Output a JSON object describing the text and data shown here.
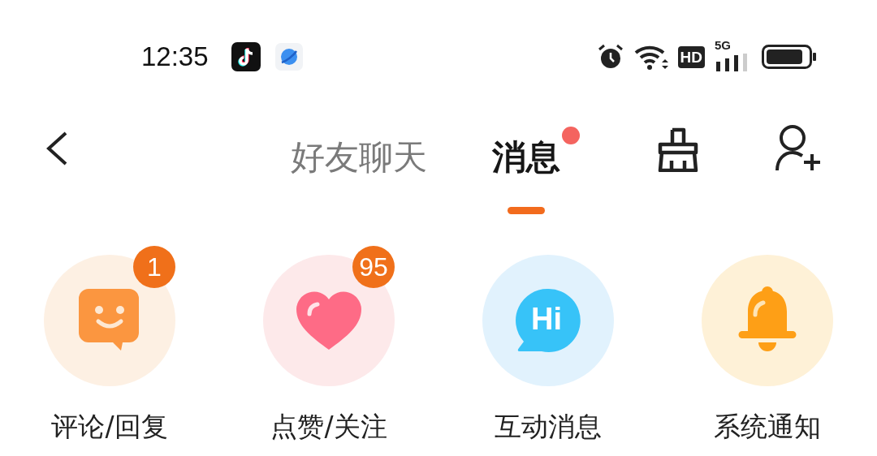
{
  "status_bar": {
    "time": "12:35",
    "hd": "HD",
    "network": "5G"
  },
  "nav": {
    "tabs": [
      {
        "label": "好友聊天",
        "selected": false,
        "dot": false
      },
      {
        "label": "消息",
        "selected": true,
        "dot": true
      }
    ]
  },
  "categories": [
    {
      "kind": "comment",
      "label": "评论/回复",
      "badge": "1"
    },
    {
      "kind": "like",
      "label": "点赞/关注",
      "badge": "95"
    },
    {
      "kind": "hi",
      "label": "互动消息",
      "icon_text": "Hi"
    },
    {
      "kind": "bell",
      "label": "系统通知"
    }
  ]
}
